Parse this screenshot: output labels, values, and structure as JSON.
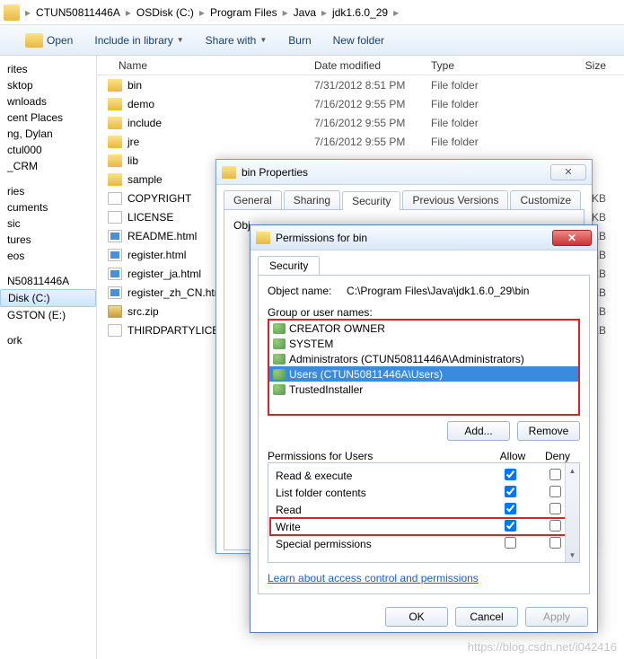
{
  "breadcrumb": [
    "CTUN50811446A",
    "OSDisk (C:)",
    "Program Files",
    "Java",
    "jdk1.6.0_29"
  ],
  "toolbar": {
    "open": "Open",
    "include": "Include in library",
    "share": "Share with",
    "burn": "Burn",
    "newfolder": "New folder"
  },
  "cols": {
    "name": "Name",
    "date": "Date modified",
    "type": "Type",
    "size": "Size"
  },
  "nav": [
    "rites",
    "sktop",
    "wnloads",
    "cent Places",
    "ng, Dylan",
    "ctul000",
    "_CRM",
    "",
    "ries",
    "cuments",
    "sic",
    "tures",
    "eos",
    "",
    "N50811446A",
    "Disk (C:)",
    "GSTON (E:)",
    "",
    "ork"
  ],
  "nav_selected": 15,
  "files": [
    {
      "ico": "folder",
      "name": "bin",
      "date": "7/31/2012 8:51 PM",
      "type": "File folder",
      "size": ""
    },
    {
      "ico": "folder",
      "name": "demo",
      "date": "7/16/2012 9:55 PM",
      "type": "File folder",
      "size": ""
    },
    {
      "ico": "folder",
      "name": "include",
      "date": "7/16/2012 9:55 PM",
      "type": "File folder",
      "size": ""
    },
    {
      "ico": "folder",
      "name": "jre",
      "date": "7/16/2012 9:55 PM",
      "type": "File folder",
      "size": ""
    },
    {
      "ico": "folder",
      "name": "lib",
      "date": "",
      "type": "",
      "size": ""
    },
    {
      "ico": "folder",
      "name": "sample",
      "date": "",
      "type": "",
      "size": ""
    },
    {
      "ico": "file",
      "name": "COPYRIGHT",
      "date": "",
      "type": "",
      "size": "4 KB"
    },
    {
      "ico": "file",
      "name": "LICENSE",
      "date": "",
      "type": "",
      "size": "KB"
    },
    {
      "ico": "htm",
      "name": "README.html",
      "date": "",
      "type": "",
      "size": "KB"
    },
    {
      "ico": "htm",
      "name": "register.html",
      "date": "",
      "type": "",
      "size": "KB"
    },
    {
      "ico": "htm",
      "name": "register_ja.html",
      "date": "",
      "type": "",
      "size": "KB"
    },
    {
      "ico": "htm",
      "name": "register_zh_CN.html",
      "date": "",
      "type": "",
      "size": "KB"
    },
    {
      "ico": "zip",
      "name": "src.zip",
      "date": "",
      "type": "",
      "size": "KB"
    },
    {
      "ico": "file",
      "name": "THIRDPARTYLICENSE",
      "date": "",
      "type": "",
      "size": "KB"
    }
  ],
  "props": {
    "title": "bin Properties",
    "tabs": [
      "General",
      "Sharing",
      "Security",
      "Previous Versions",
      "Customize"
    ],
    "active_tab": 2,
    "obj": "Obj"
  },
  "perm": {
    "title": "Permissions for bin",
    "tab": "Security",
    "object_label": "Object name:",
    "object_value": "C:\\Program Files\\Java\\jdk1.6.0_29\\bin",
    "group_label": "Group or user names:",
    "groups": [
      "CREATOR OWNER",
      "SYSTEM",
      "Administrators (CTUN50811446A\\Administrators)",
      "Users (CTUN50811446A\\Users)",
      "TrustedInstaller"
    ],
    "group_selected": 3,
    "add": "Add...",
    "remove": "Remove",
    "perm_for": "Permissions for Users",
    "allow": "Allow",
    "deny": "Deny",
    "perms": [
      {
        "name": "Read & execute",
        "allow": true,
        "deny": false,
        "hl": false
      },
      {
        "name": "List folder contents",
        "allow": true,
        "deny": false,
        "hl": false
      },
      {
        "name": "Read",
        "allow": true,
        "deny": false,
        "hl": false
      },
      {
        "name": "Write",
        "allow": true,
        "deny": false,
        "hl": true
      },
      {
        "name": "Special permissions",
        "allow": false,
        "deny": false,
        "hl": false
      }
    ],
    "learn": "Learn about access control and permissions",
    "ok": "OK",
    "cancel": "Cancel",
    "apply": "Apply"
  },
  "watermark": "https://blog.csdn.net/i042416"
}
